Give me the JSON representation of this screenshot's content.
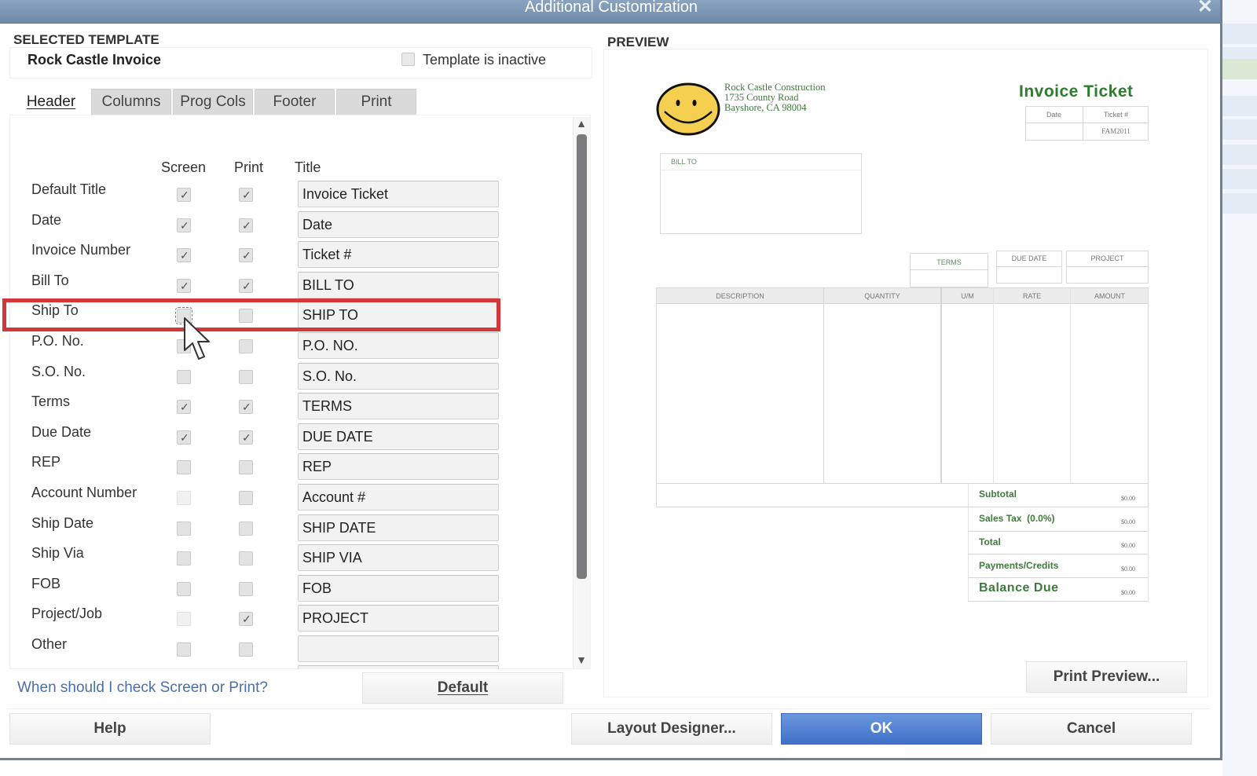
{
  "window": {
    "title": "Additional Customization",
    "close_icon": "close-x-icon"
  },
  "selected_template": {
    "section_label": "SELECTED TEMPLATE",
    "name": "Rock Castle Invoice",
    "inactive_label": "Template is inactive",
    "inactive_checked": false
  },
  "tabs": [
    {
      "label": "Header",
      "active": true
    },
    {
      "label": "Columns",
      "active": false
    },
    {
      "label": "Prog Cols",
      "active": false
    },
    {
      "label": "Footer",
      "active": false
    },
    {
      "label": "Print",
      "active": false
    }
  ],
  "columns": {
    "screen": "Screen",
    "print": "Print",
    "title": "Title"
  },
  "fields": [
    {
      "label": "Default Title",
      "screen": true,
      "print": true,
      "title": "Invoice Ticket"
    },
    {
      "label": "Date",
      "screen": true,
      "print": true,
      "title": "Date"
    },
    {
      "label": "Invoice Number",
      "screen": true,
      "print": true,
      "title": "Ticket #"
    },
    {
      "label": "Bill To",
      "screen": true,
      "print": true,
      "title": "BILL TO"
    },
    {
      "label": "Ship To",
      "screen": false,
      "print": false,
      "title": "SHIP TO",
      "highlighted": true
    },
    {
      "label": "P.O. No.",
      "screen": false,
      "print": false,
      "title": "P.O. NO."
    },
    {
      "label": "S.O. No.",
      "screen": false,
      "print": false,
      "title": "S.O. No."
    },
    {
      "label": "Terms",
      "screen": true,
      "print": true,
      "title": "TERMS"
    },
    {
      "label": "Due Date",
      "screen": true,
      "print": true,
      "title": "DUE DATE"
    },
    {
      "label": "REP",
      "screen": false,
      "print": false,
      "title": "REP"
    },
    {
      "label": "Account Number",
      "screen": false,
      "screen_disabled": true,
      "print": false,
      "title": "Account #"
    },
    {
      "label": "Ship Date",
      "screen": false,
      "print": false,
      "title": "SHIP DATE"
    },
    {
      "label": "Ship Via",
      "screen": false,
      "print": false,
      "title": "SHIP VIA"
    },
    {
      "label": "FOB",
      "screen": false,
      "print": false,
      "title": "FOB"
    },
    {
      "label": "Project/Job",
      "screen": false,
      "screen_disabled": true,
      "print": true,
      "title": "PROJECT"
    },
    {
      "label": "Other",
      "screen": false,
      "print": false,
      "title": ""
    }
  ],
  "help_link": "When should I check Screen or Print?",
  "buttons": {
    "default": "Default",
    "help": "Help",
    "layout_designer": "Layout Designer...",
    "ok": "OK",
    "cancel": "Cancel",
    "print_preview": "Print Preview..."
  },
  "preview": {
    "section_label": "PREVIEW",
    "logo_icon": "smiley-face-logo",
    "company": [
      "Rock Castle Construction",
      "1735 County Road",
      "Bayshore, CA 98004"
    ],
    "doc_title": "Invoice Ticket",
    "header_boxes": {
      "date_label": "Date",
      "ticket_label": "Ticket #",
      "ticket_value": "FAM2011"
    },
    "bill_to_label": "BILL TO",
    "info_boxes": [
      "TERMS",
      "DUE DATE",
      "PROJECT"
    ],
    "line_columns": [
      "DESCRIPTION",
      "QUANTITY",
      "U/M",
      "RATE",
      "AMOUNT"
    ],
    "totals": [
      {
        "label": "Subtotal",
        "value": "$0.00"
      },
      {
        "label": "Sales Tax  (0.0%)",
        "value": "$0.00"
      },
      {
        "label": "Total",
        "value": "$0.00"
      },
      {
        "label": "Payments/Credits",
        "value": "$0.00"
      },
      {
        "label": "Balance Due",
        "value": "$0.00"
      }
    ]
  },
  "colors": {
    "accent_green": "#3f7a3c",
    "highlight_red": "#d0383a",
    "primary_blue": "#4f7fd0",
    "link_blue": "#4a6fa8"
  }
}
